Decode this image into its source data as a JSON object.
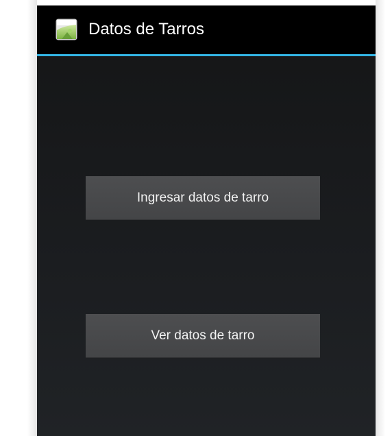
{
  "action_bar": {
    "title": "Datos de Tarros",
    "icon": "android-launcher-icon",
    "divider_color": "#33b5e5"
  },
  "buttons": [
    {
      "label": "Ingresar datos de tarro"
    },
    {
      "label": "Ver datos de tarro"
    }
  ],
  "colors": {
    "action_bar_bg": "#000000",
    "screen_bg": "#1b1d20",
    "button_bg": "#4a4b4d",
    "text": "#ffffff"
  }
}
